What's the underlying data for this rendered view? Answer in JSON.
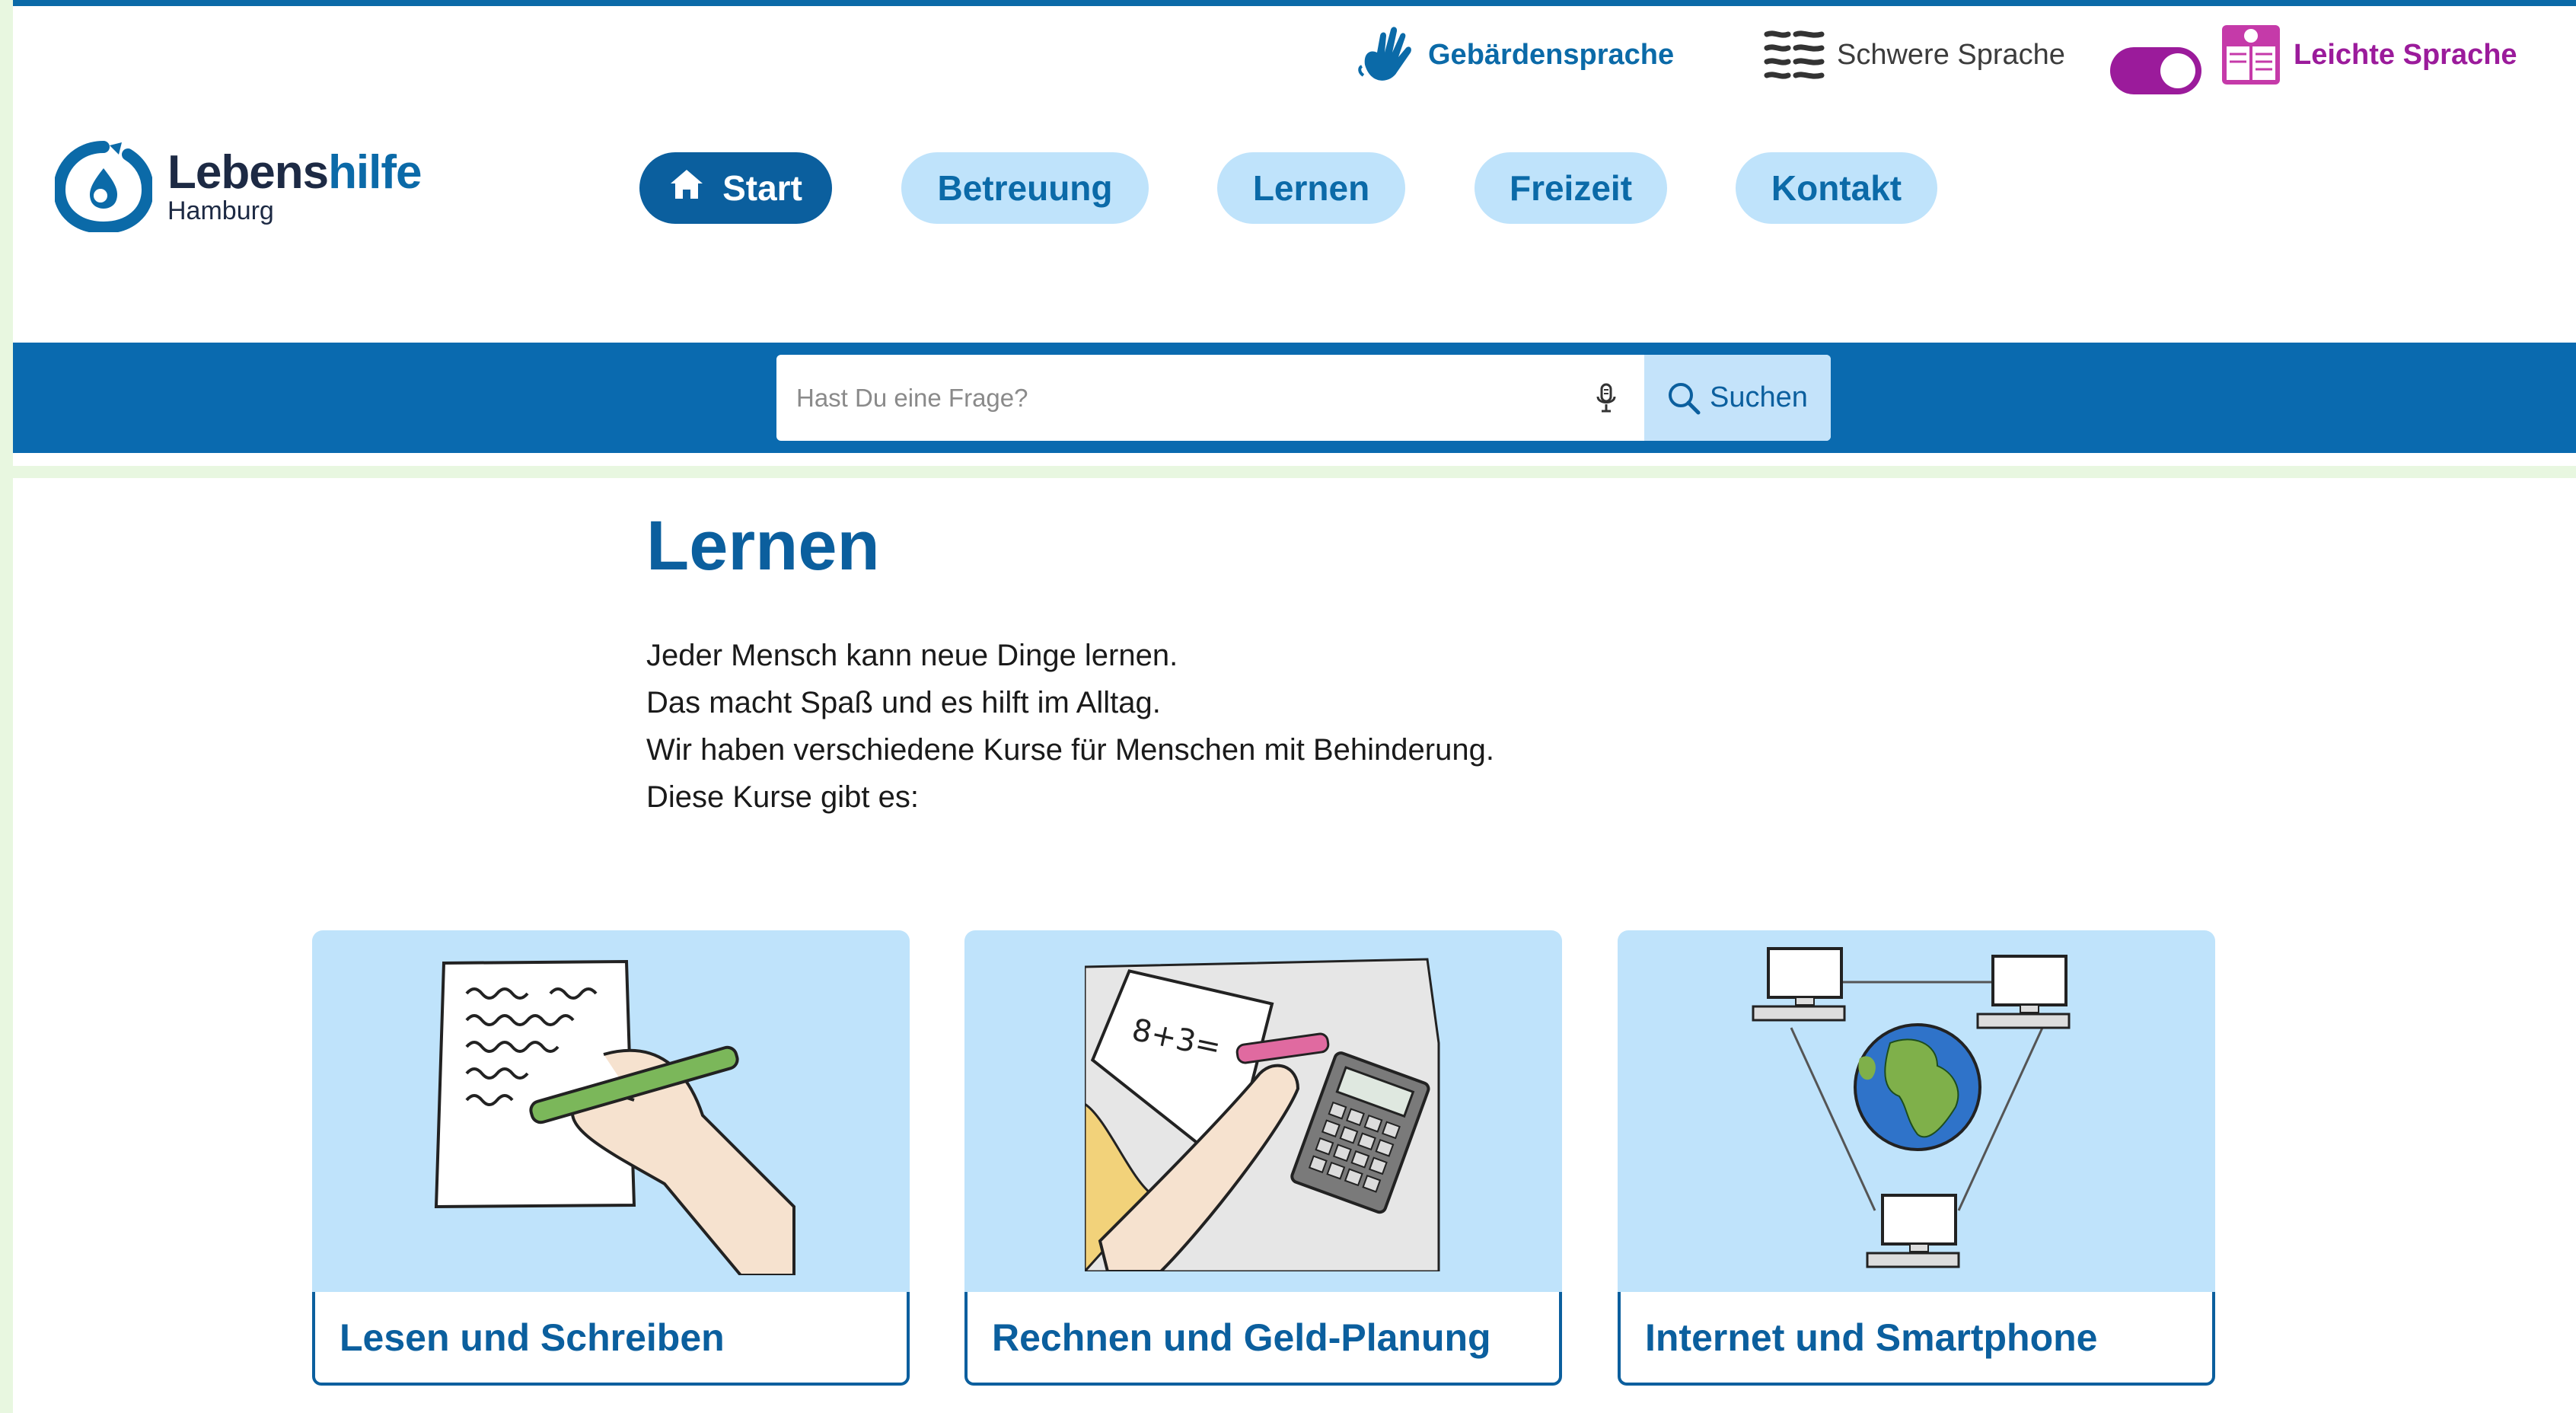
{
  "languages": {
    "gebaerden_label": "Gebärdensprache",
    "schwer_label": "Schwere Sprache",
    "leicht_label": "Leichte Sprache",
    "toggle_state": "on",
    "gebaerden_icon": "sign-language-hand-icon",
    "schwer_icon": "text-lines-icon",
    "leicht_icon": "easy-reading-book-icon"
  },
  "logo": {
    "main_a": "Lebens",
    "main_b": "hilfe",
    "sub": "Hamburg"
  },
  "nav": {
    "items": [
      {
        "label": "Start",
        "active": true
      },
      {
        "label": "Betreuung"
      },
      {
        "label": "Lernen"
      },
      {
        "label": "Freizeit"
      },
      {
        "label": "Kontakt"
      }
    ]
  },
  "search": {
    "placeholder": "Hast Du eine Frage?",
    "button_label": "Suchen"
  },
  "main": {
    "title": "Lernen",
    "intro": [
      "Jeder Mensch kann neue Dinge lernen.",
      "Das macht Spaß und es hilft im Alltag.",
      "Wir haben verschiedene Kurse für Menschen mit Behinderung.",
      "Diese Kurse gibt es:"
    ],
    "cards": [
      {
        "label": "Lesen und Schreiben",
        "icon": "writing-hand-icon"
      },
      {
        "label": "Rechnen und Geld-Planung",
        "icon": "calculator-math-icon"
      },
      {
        "label": "Internet und Smartphone",
        "icon": "globe-network-icon"
      }
    ]
  },
  "colors": {
    "brand_blue": "#0b5f9e",
    "light_blue": "#bfe3fb",
    "purple": "#9b1b9b"
  }
}
